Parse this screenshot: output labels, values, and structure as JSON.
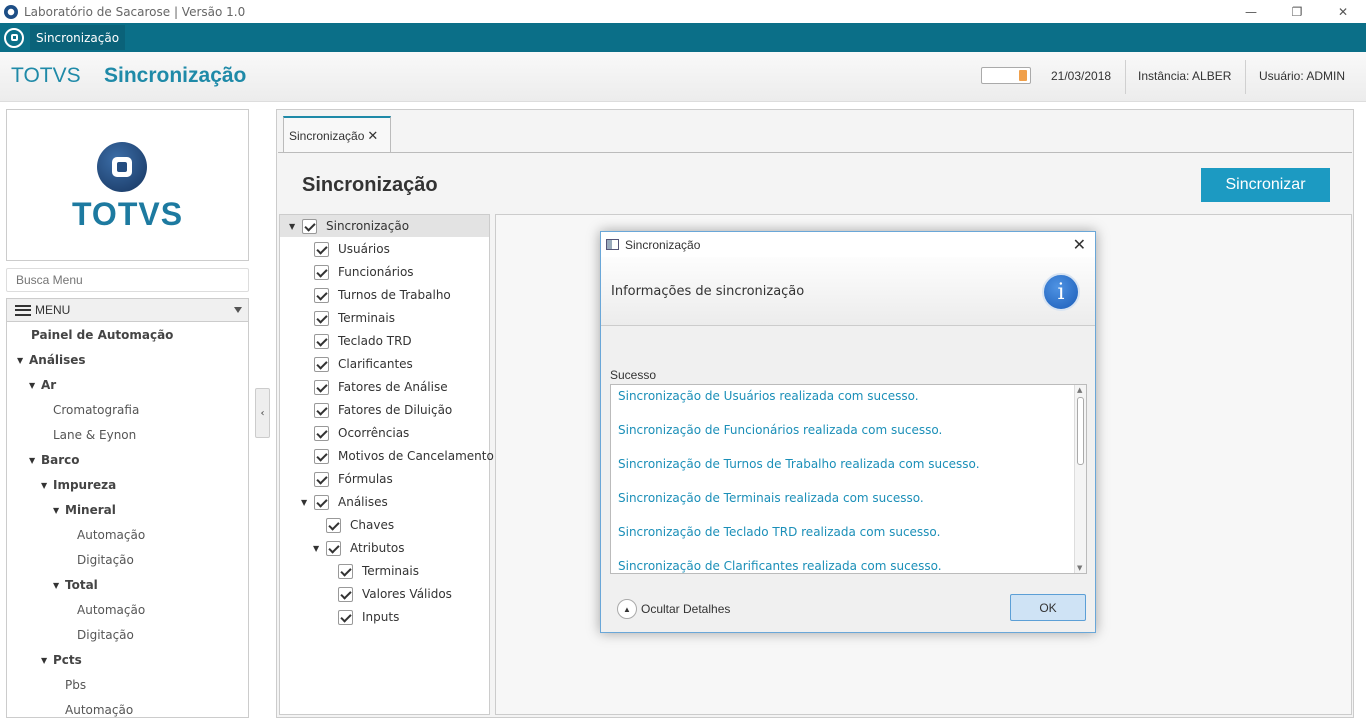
{
  "window": {
    "title": "Laboratório de Sacarose | Versão 1.0",
    "minimize": "—",
    "restore": "❐",
    "close": "✕"
  },
  "appbar": {
    "tab_label": "Sincronização"
  },
  "header": {
    "brand": "TOTVS",
    "title": "Sincronização",
    "date": "21/03/2018",
    "instance": "Instância: ALBER",
    "user": "Usuário: ADMIN",
    "battery_level": 0.2
  },
  "sidebar": {
    "logo_text": "TOTVS",
    "search_placeholder": "Busca Menu",
    "menu_label": "MENU",
    "collapse_glyph": "‹",
    "items": [
      {
        "label": "Painel de Automação",
        "level": 0,
        "bold": true,
        "arrow": ""
      },
      {
        "label": "Análises",
        "level": 0,
        "bold": true,
        "arrow": "▼"
      },
      {
        "label": "Ar",
        "level": 1,
        "bold": true,
        "arrow": "▼"
      },
      {
        "label": "Cromatografia",
        "level": 2,
        "bold": false,
        "arrow": ""
      },
      {
        "label": "Lane & Eynon",
        "level": 2,
        "bold": false,
        "arrow": ""
      },
      {
        "label": "Barco",
        "level": 1,
        "bold": true,
        "arrow": "▼"
      },
      {
        "label": "Impureza",
        "level": 2,
        "bold": true,
        "arrow": "▼"
      },
      {
        "label": "Mineral",
        "level": 3,
        "bold": true,
        "arrow": "▼"
      },
      {
        "label": "Automação",
        "level": 4,
        "bold": false,
        "arrow": ""
      },
      {
        "label": "Digitação",
        "level": 4,
        "bold": false,
        "arrow": ""
      },
      {
        "label": "Total",
        "level": 3,
        "bold": true,
        "arrow": "▼"
      },
      {
        "label": "Automação",
        "level": 4,
        "bold": false,
        "arrow": ""
      },
      {
        "label": "Digitação",
        "level": 4,
        "bold": false,
        "arrow": ""
      },
      {
        "label": "Pcts",
        "level": 2,
        "bold": true,
        "arrow": "▼"
      },
      {
        "label": "Pbs",
        "level": 3,
        "bold": false,
        "arrow": ""
      },
      {
        "label": "Automação",
        "level": 3,
        "bold": false,
        "arrow": ""
      }
    ]
  },
  "main": {
    "tab_label": "Sincronização",
    "tab_close": "✕",
    "page_title": "Sincronização",
    "sync_button": "Sincronizar",
    "tree": [
      {
        "label": "Sincronização",
        "level": 0,
        "arrow": "▼",
        "checked": true
      },
      {
        "label": "Usuários",
        "level": 1,
        "arrow": "",
        "checked": true
      },
      {
        "label": "Funcionários",
        "level": 1,
        "arrow": "",
        "checked": true
      },
      {
        "label": "Turnos de Trabalho",
        "level": 1,
        "arrow": "",
        "checked": true
      },
      {
        "label": "Terminais",
        "level": 1,
        "arrow": "",
        "checked": true
      },
      {
        "label": "Teclado TRD",
        "level": 1,
        "arrow": "",
        "checked": true
      },
      {
        "label": "Clarificantes",
        "level": 1,
        "arrow": "",
        "checked": true
      },
      {
        "label": "Fatores de Análise",
        "level": 1,
        "arrow": "",
        "checked": true
      },
      {
        "label": "Fatores de Diluição",
        "level": 1,
        "arrow": "",
        "checked": true
      },
      {
        "label": "Ocorrências",
        "level": 1,
        "arrow": "",
        "checked": true
      },
      {
        "label": "Motivos de Cancelamento",
        "level": 1,
        "arrow": "",
        "checked": true
      },
      {
        "label": "Fórmulas",
        "level": 1,
        "arrow": "",
        "checked": true
      },
      {
        "label": "Análises",
        "level": 1,
        "arrow": "▼",
        "checked": true
      },
      {
        "label": "Chaves",
        "level": 2,
        "arrow": "",
        "checked": true
      },
      {
        "label": "Atributos",
        "level": 2,
        "arrow": "▼",
        "checked": true
      },
      {
        "label": "Terminais",
        "level": 3,
        "arrow": "",
        "checked": true
      },
      {
        "label": "Valores Válidos",
        "level": 3,
        "arrow": "",
        "checked": true
      },
      {
        "label": "Inputs",
        "level": 3,
        "arrow": "",
        "checked": true
      }
    ]
  },
  "dialog": {
    "title": "Sincronização",
    "close": "✕",
    "header_text": "Informações de sincronização",
    "info_glyph": "i",
    "section_label": "Sucesso",
    "messages": [
      "Sincronização de Usuários realizada com sucesso.",
      "Sincronização de Funcionários realizada com sucesso.",
      "Sincronização de Turnos de Trabalho realizada com sucesso.",
      "Sincronização de Terminais realizada com sucesso.",
      "Sincronização de Teclado TRD realizada com sucesso.",
      "Sincronização de Clarificantes realizada com sucesso."
    ],
    "details_toggle": "Ocultar Detalhes",
    "ok_label": "OK"
  },
  "colors": {
    "accent": "#1c9ac2",
    "appbar": "#0b6f88",
    "brand_text": "#1f8aa8",
    "message_text": "#1b8fb8"
  }
}
